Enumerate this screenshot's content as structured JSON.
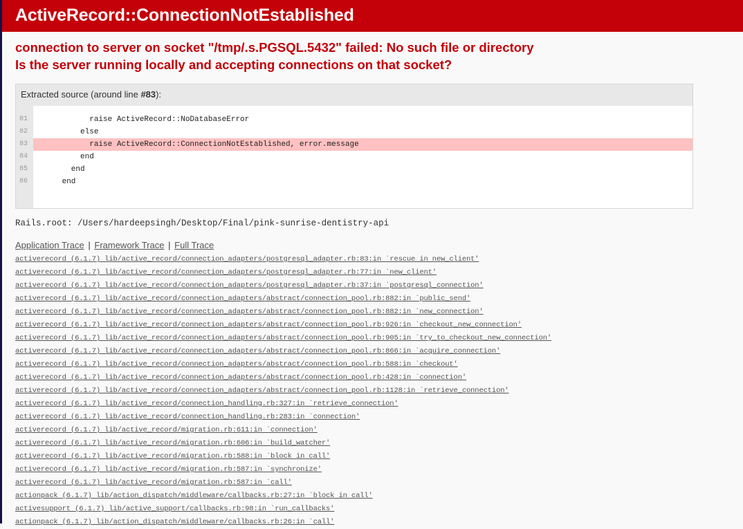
{
  "header": {
    "title": "ActiveRecord::ConnectionNotEstablished"
  },
  "exception": {
    "message_lines": [
      "connection to server on socket \"/tmp/.s.PGSQL.5432\" failed: No such file or directory",
      "Is the server running locally and accepting connections on that socket?"
    ]
  },
  "source": {
    "title_prefix": "Extracted source (around line ",
    "title_line": "#83",
    "title_suffix": "):",
    "lines": [
      {
        "number": "81",
        "code": "            raise ActiveRecord::NoDatabaseError",
        "highlighted": false
      },
      {
        "number": "82",
        "code": "          else",
        "highlighted": false
      },
      {
        "number": "83",
        "code": "            raise ActiveRecord::ConnectionNotEstablished, error.message",
        "highlighted": true
      },
      {
        "number": "84",
        "code": "          end",
        "highlighted": false
      },
      {
        "number": "85",
        "code": "        end",
        "highlighted": false
      },
      {
        "number": "86",
        "code": "      end",
        "highlighted": false
      }
    ]
  },
  "rails_root": "Rails.root: /Users/hardeepsingh/Desktop/Final/pink-sunrise-dentistry-api",
  "trace_tabs": {
    "application": "Application Trace",
    "framework": "Framework Trace",
    "full": "Full Trace",
    "separator": "|"
  },
  "trace": [
    "activerecord (6.1.7) lib/active_record/connection_adapters/postgresql_adapter.rb:83:in `rescue in new_client'",
    "activerecord (6.1.7) lib/active_record/connection_adapters/postgresql_adapter.rb:77:in `new_client'",
    "activerecord (6.1.7) lib/active_record/connection_adapters/postgresql_adapter.rb:37:in `postgresql_connection'",
    "activerecord (6.1.7) lib/active_record/connection_adapters/abstract/connection_pool.rb:882:in `public_send'",
    "activerecord (6.1.7) lib/active_record/connection_adapters/abstract/connection_pool.rb:882:in `new_connection'",
    "activerecord (6.1.7) lib/active_record/connection_adapters/abstract/connection_pool.rb:926:in `checkout_new_connection'",
    "activerecord (6.1.7) lib/active_record/connection_adapters/abstract/connection_pool.rb:905:in `try_to_checkout_new_connection'",
    "activerecord (6.1.7) lib/active_record/connection_adapters/abstract/connection_pool.rb:866:in `acquire_connection'",
    "activerecord (6.1.7) lib/active_record/connection_adapters/abstract/connection_pool.rb:588:in `checkout'",
    "activerecord (6.1.7) lib/active_record/connection_adapters/abstract/connection_pool.rb:428:in `connection'",
    "activerecord (6.1.7) lib/active_record/connection_adapters/abstract/connection_pool.rb:1128:in `retrieve_connection'",
    "activerecord (6.1.7) lib/active_record/connection_handling.rb:327:in `retrieve_connection'",
    "activerecord (6.1.7) lib/active_record/connection_handling.rb:283:in `connection'",
    "activerecord (6.1.7) lib/active_record/migration.rb:611:in `connection'",
    "activerecord (6.1.7) lib/active_record/migration.rb:606:in `build_watcher'",
    "activerecord (6.1.7) lib/active_record/migration.rb:588:in `block in call'",
    "activerecord (6.1.7) lib/active_record/migration.rb:587:in `synchronize'",
    "activerecord (6.1.7) lib/active_record/migration.rb:587:in `call'",
    "actionpack (6.1.7) lib/action_dispatch/middleware/callbacks.rb:27:in `block in call'",
    "activesupport (6.1.7) lib/active_support/callbacks.rb:98:in `run_callbacks'",
    "actionpack (6.1.7) lib/action_dispatch/middleware/callbacks.rb:26:in `call'"
  ],
  "colors": {
    "header_bg": "#C40008",
    "error_text": "#C40008",
    "highlight_line": "#FFC1C1",
    "page_bg": "#F9F9F9"
  }
}
